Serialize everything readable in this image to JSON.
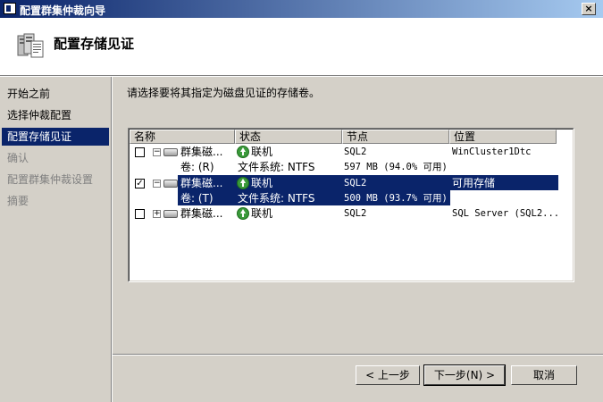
{
  "window": {
    "title": "配置群集仲裁向导",
    "close_glyph": "×"
  },
  "header": {
    "title": "配置存储见证",
    "icon": "cluster-server-icon"
  },
  "nav": {
    "items": [
      {
        "label": "开始之前",
        "state": "normal"
      },
      {
        "label": "选择仲裁配置",
        "state": "normal"
      },
      {
        "label": "配置存储见证",
        "state": "active"
      },
      {
        "label": "确认",
        "state": "disabled"
      },
      {
        "label": "配置群集仲裁设置",
        "state": "disabled"
      },
      {
        "label": "摘要",
        "state": "disabled"
      }
    ]
  },
  "main": {
    "instruction": "请选择要将其指定为磁盘见证的存储卷。"
  },
  "table": {
    "columns": [
      "名称",
      "状态",
      "节点",
      "位置"
    ],
    "rows": [
      {
        "checked": false,
        "expander": "−",
        "name": "群集磁...",
        "status": "联机",
        "node": "SQL2",
        "location": "WinCluster1Dtc",
        "sub": {
          "volume": "卷: (R)",
          "fs": "文件系统: NTFS",
          "size": "597 MB (94.0% 可用)"
        },
        "selected": false
      },
      {
        "checked": true,
        "expander": "−",
        "name": "群集磁...",
        "status": "联机",
        "node": "SQL2",
        "location": "可用存储",
        "sub": {
          "volume": "卷: (T)",
          "fs": "文件系统: NTFS",
          "size": "500 MB (93.7% 可用)"
        },
        "selected": true
      },
      {
        "checked": false,
        "expander": "+",
        "name": "群集磁...",
        "status": "联机",
        "node": "SQL2",
        "location": "SQL Server (SQL2...",
        "sub": null,
        "selected": false
      }
    ],
    "check_glyph": "✓"
  },
  "buttons": {
    "prev": "< 上一步",
    "next": "下一步(N) >",
    "cancel": "取消"
  },
  "colors": {
    "selection": "#0a246a",
    "title_gradient_start": "#0a246a",
    "title_gradient_end": "#a6caf0"
  }
}
